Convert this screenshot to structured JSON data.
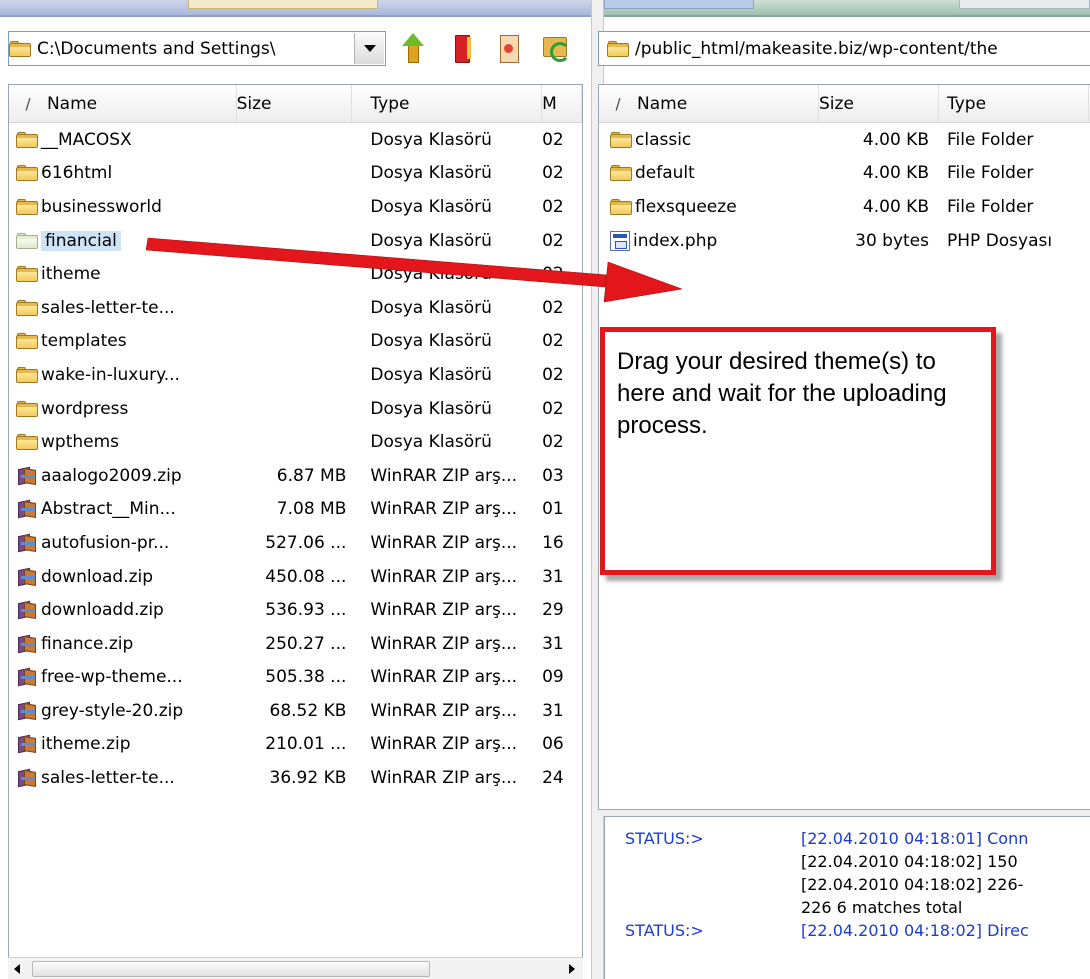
{
  "left": {
    "path": "C:\\Documents and Settings\\",
    "columns": {
      "sort": "/",
      "name": "Name",
      "size": "Size",
      "type": "Type",
      "modified": "M"
    },
    "rows": [
      {
        "icon": "folder-icon",
        "name": "__MACOSX",
        "size": "",
        "type": "Dosya Klasörü",
        "modified": "02"
      },
      {
        "icon": "folder-icon",
        "name": "616html",
        "size": "",
        "type": "Dosya Klasörü",
        "modified": "02"
      },
      {
        "icon": "folder-icon",
        "name": "businessworld",
        "size": "",
        "type": "Dosya Klasörü",
        "modified": "02"
      },
      {
        "icon": "folder-icon",
        "name": "financial",
        "size": "",
        "type": "Dosya Klasörü",
        "modified": "02",
        "selected": true
      },
      {
        "icon": "folder-icon",
        "name": "itheme",
        "size": "",
        "type": "Dosya Klasörü",
        "modified": "02"
      },
      {
        "icon": "folder-icon",
        "name": "sales-letter-te...",
        "size": "",
        "type": "Dosya Klasörü",
        "modified": "02"
      },
      {
        "icon": "folder-icon",
        "name": "templates",
        "size": "",
        "type": "Dosya Klasörü",
        "modified": "02"
      },
      {
        "icon": "folder-icon",
        "name": "wake-in-luxury...",
        "size": "",
        "type": "Dosya Klasörü",
        "modified": "02"
      },
      {
        "icon": "folder-icon",
        "name": "wordpress",
        "size": "",
        "type": "Dosya Klasörü",
        "modified": "02"
      },
      {
        "icon": "folder-icon",
        "name": "wpthems",
        "size": "",
        "type": "Dosya Klasörü",
        "modified": "02"
      },
      {
        "icon": "zip-icon",
        "name": "aaalogo2009.zip",
        "size": "6.87 MB",
        "type": "WinRAR ZIP arş...",
        "modified": "03"
      },
      {
        "icon": "zip-icon",
        "name": "Abstract__Min...",
        "size": "7.08 MB",
        "type": "WinRAR ZIP arş...",
        "modified": "01"
      },
      {
        "icon": "zip-icon",
        "name": "autofusion-pr...",
        "size": "527.06 ...",
        "type": "WinRAR ZIP arş...",
        "modified": "16"
      },
      {
        "icon": "zip-icon",
        "name": "download.zip",
        "size": "450.08 ...",
        "type": "WinRAR ZIP arş...",
        "modified": "31"
      },
      {
        "icon": "zip-icon",
        "name": "downloadd.zip",
        "size": "536.93 ...",
        "type": "WinRAR ZIP arş...",
        "modified": "29"
      },
      {
        "icon": "zip-icon",
        "name": "finance.zip",
        "size": "250.27 ...",
        "type": "WinRAR ZIP arş...",
        "modified": "31"
      },
      {
        "icon": "zip-icon",
        "name": "free-wp-theme...",
        "size": "505.38 ...",
        "type": "WinRAR ZIP arş...",
        "modified": "09"
      },
      {
        "icon": "zip-icon",
        "name": "grey-style-20.zip",
        "size": "68.52 KB",
        "type": "WinRAR ZIP arş...",
        "modified": "31"
      },
      {
        "icon": "zip-icon",
        "name": "itheme.zip",
        "size": "210.01 ...",
        "type": "WinRAR ZIP arş...",
        "modified": "06"
      },
      {
        "icon": "zip-icon",
        "name": "sales-letter-te...",
        "size": "36.92 KB",
        "type": "WinRAR ZIP arş...",
        "modified": "24"
      }
    ]
  },
  "right": {
    "path": "/public_html/makeasite.biz/wp-content/the",
    "columns": {
      "sort": "/",
      "name": "Name",
      "size": "Size",
      "type": "Type"
    },
    "rows": [
      {
        "icon": "folder-icon",
        "name": "classic",
        "size": "4.00 KB",
        "type": "File Folder"
      },
      {
        "icon": "folder-icon",
        "name": "default",
        "size": "4.00 KB",
        "type": "File Folder"
      },
      {
        "icon": "folder-icon",
        "name": "flexsqueeze",
        "size": "4.00 KB",
        "type": "File Folder"
      },
      {
        "icon": "php-file-icon",
        "name": "index.php",
        "size": "30 bytes",
        "type": "PHP Dosyası"
      }
    ]
  },
  "log": [
    {
      "label": "STATUS:>",
      "message": "[22.04.2010 04:18:01] Conn",
      "highlight": true
    },
    {
      "label": "",
      "message": "[22.04.2010 04:18:02] 150",
      "highlight": false
    },
    {
      "label": "",
      "message": "[22.04.2010 04:18:02] 226-",
      "highlight": false
    },
    {
      "label": "",
      "message": "226 6 matches total",
      "highlight": false
    },
    {
      "label": "STATUS:>",
      "message": "[22.04.2010 04:18:02] Direc",
      "highlight": true
    }
  ],
  "annotation": {
    "text": "Drag your desired theme(s) to here and wait for the uploading process."
  },
  "colors": {
    "annotation_red": "#e2161b",
    "status_blue": "#1a3ccf",
    "selection": "#cfe3f7"
  }
}
